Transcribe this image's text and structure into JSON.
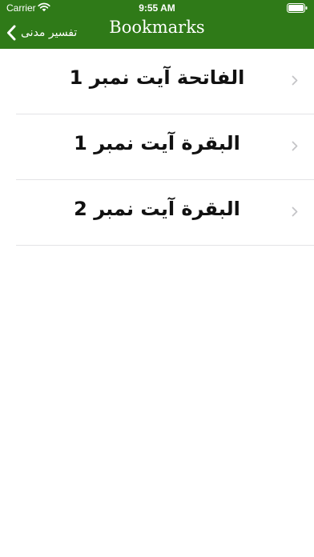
{
  "status_bar": {
    "carrier": "Carrier",
    "time": "9:55 AM"
  },
  "navbar": {
    "back_label": "تفسیر مدنی",
    "title": "Bookmarks"
  },
  "bookmarks": [
    {
      "label": "الفاتحة آیت نمبر 1"
    },
    {
      "label": "البقرة آیت نمبر 1"
    },
    {
      "label": "البقرة آیت نمبر 2"
    }
  ],
  "colors": {
    "header": "#2f7a18",
    "separator": "#e3e3e6",
    "chevron": "#c4c4c7"
  }
}
